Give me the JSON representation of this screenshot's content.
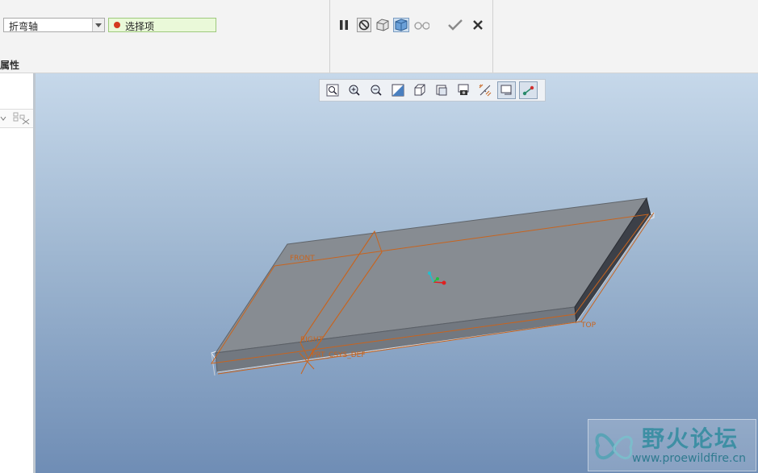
{
  "ribbon": {
    "bend_axis_value": "折弯轴",
    "collector_label": "选择项",
    "properties_tab": "属性"
  },
  "dashboard_controls": [
    "pause-icon",
    "no-preview-icon",
    "verify-mode-icon",
    "dynamic-preview-icon",
    "glasses-icon",
    "ok-check-icon",
    "cancel-x-icon"
  ],
  "view_toolbar": [
    "refit-icon",
    "zoom-in-icon",
    "zoom-out-icon",
    "repaint-icon",
    "display-style-icon",
    "saved-views-icon",
    "view-manager-icon",
    "datum-display-icon",
    "spin-center-icon",
    "annotation-display-icon"
  ],
  "model": {
    "labels": {
      "front": "FRONT",
      "right": "RIGHT",
      "top": "TOP",
      "csys": "PRT_CSYS_DEF"
    }
  },
  "watermark": {
    "title": "野火论坛",
    "url": "www.proewildfire.cn"
  },
  "colors": {
    "datum": "#c8641e",
    "face_top": "#878c92",
    "face_front": "#727880",
    "face_side": "#3c4048",
    "collector_bg": "#eaf9d9",
    "csys_x": "#e02020",
    "csys_y": "#20c040",
    "csys_z": "#20c0d0"
  }
}
